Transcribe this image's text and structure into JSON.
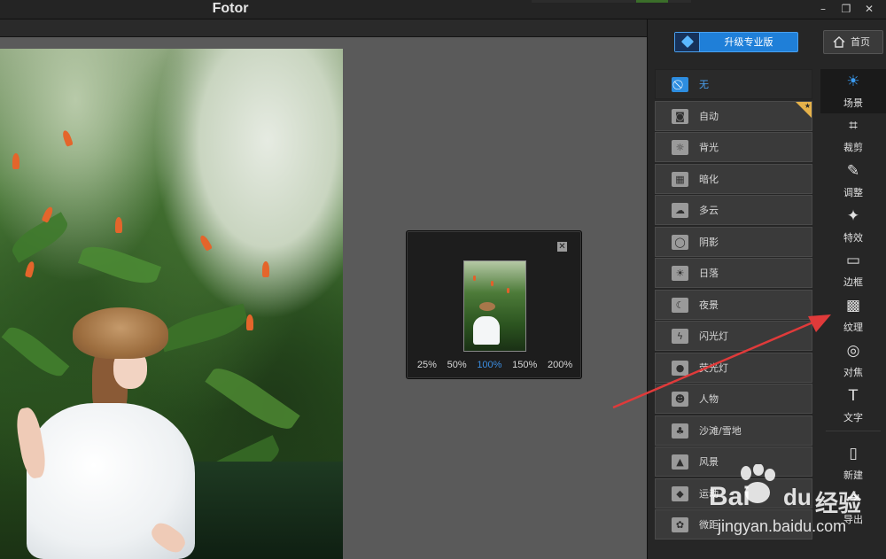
{
  "window": {
    "title": "Fotor",
    "controls": {
      "minimize": "–",
      "restore": "❐",
      "close": "✕"
    }
  },
  "zoom_popup": {
    "close": "✕",
    "levels": [
      "25%",
      "50%",
      "100%",
      "150%",
      "200%"
    ],
    "selected": "100%"
  },
  "header": {
    "upgrade_label": "升级专业版",
    "home_label": "首页"
  },
  "scene_list": {
    "items": [
      {
        "label": "无",
        "icon": "ban-icon",
        "glyph": "⃠"
      },
      {
        "label": "自动",
        "icon": "camera-icon",
        "glyph": "◙"
      },
      {
        "label": "背光",
        "icon": "backlight-icon",
        "glyph": "☼"
      },
      {
        "label": "暗化",
        "icon": "darken-icon",
        "glyph": "▦"
      },
      {
        "label": "多云",
        "icon": "cloud-icon",
        "glyph": "☁"
      },
      {
        "label": "阴影",
        "icon": "shadow-icon",
        "glyph": "◯"
      },
      {
        "label": "日落",
        "icon": "sunset-icon",
        "glyph": "☀"
      },
      {
        "label": "夜景",
        "icon": "night-icon",
        "glyph": "☾"
      },
      {
        "label": "闪光灯",
        "icon": "flash-icon",
        "glyph": "ϟ"
      },
      {
        "label": "荧光灯",
        "icon": "bulb-icon",
        "glyph": "●"
      },
      {
        "label": "人物",
        "icon": "portrait-icon",
        "glyph": "☻"
      },
      {
        "label": "沙滩/雪地",
        "icon": "beach-icon",
        "glyph": "♣"
      },
      {
        "label": "风景",
        "icon": "landscape-icon",
        "glyph": "▲"
      },
      {
        "label": "运动",
        "icon": "sport-icon",
        "glyph": "◆"
      },
      {
        "label": "微距",
        "icon": "macro-icon",
        "glyph": "✿"
      }
    ],
    "selected_index": 0,
    "pro_badge_index": 1
  },
  "tools": [
    {
      "label": "场景",
      "icon": "scene-icon",
      "glyph": "☀"
    },
    {
      "label": "裁剪",
      "icon": "crop-icon",
      "glyph": "⌗"
    },
    {
      "label": "调整",
      "icon": "adjust-icon",
      "glyph": "✎"
    },
    {
      "label": "特效",
      "icon": "effects-icon",
      "glyph": "✦"
    },
    {
      "label": "边框",
      "icon": "frame-icon",
      "glyph": "▭"
    },
    {
      "label": "纹理",
      "icon": "texture-icon",
      "glyph": "▩"
    },
    {
      "label": "对焦",
      "icon": "focus-icon",
      "glyph": "◎"
    },
    {
      "label": "文字",
      "icon": "text-icon",
      "glyph": "T"
    },
    {
      "label": "新建",
      "icon": "new-file-icon",
      "glyph": "▯"
    },
    {
      "label": "导出",
      "icon": "export-icon",
      "glyph": "⇥"
    }
  ],
  "tools_active_index": 0,
  "watermark": {
    "brand": "Bai",
    "brand2": "du",
    "cn": "经验",
    "url": "jingyan.baidu.com"
  },
  "colors": {
    "accent": "#2d8de0",
    "arrow": "#e03a3a",
    "upgrade": "#1f7fd8"
  }
}
